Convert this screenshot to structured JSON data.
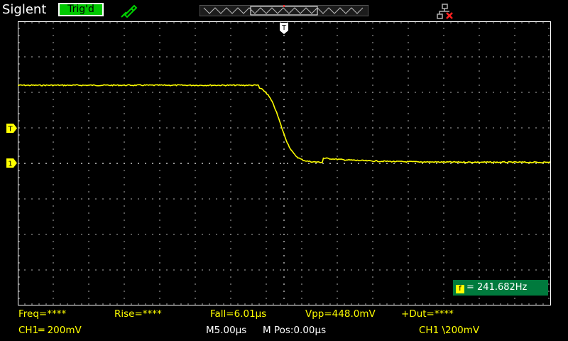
{
  "header": {
    "brand": "Siglent",
    "trigger_status": "Trig'd",
    "probe_icon": "probe-icon",
    "network_icon": "network-disconnected-icon"
  },
  "markers": {
    "trigger_position": "T",
    "trigger_level": "T",
    "channel1": "1"
  },
  "frequency_counter": {
    "icon": "f",
    "text": "= 241.682Hz"
  },
  "measurements": {
    "freq": "Freq=****",
    "rise": "Rise=****",
    "fall": "Fall=6.01μs",
    "vpp": "Vpp=448.0mV",
    "duty": "+Dut=****"
  },
  "status": {
    "ch1_coupling": "CH1═ 200mV",
    "time_base": "M5.00μs",
    "m_pos": "M Pos:0.00μs",
    "trigger_info": "CH1 \\200mV"
  },
  "colors": {
    "trace": "#ffff00",
    "trigd_bg": "#00c800",
    "counter_bg": "#007a3d",
    "grid": "#ffffff"
  }
}
